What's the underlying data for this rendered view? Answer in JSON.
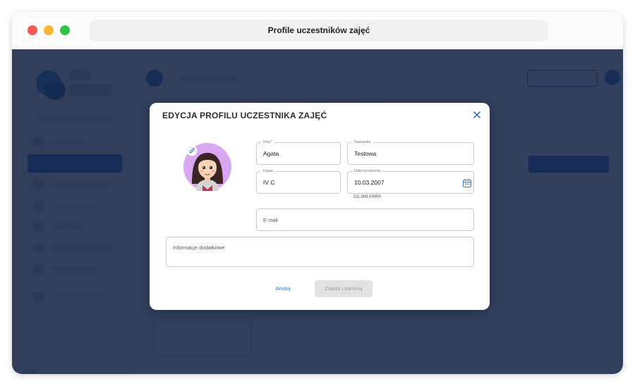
{
  "window": {
    "title": "Profile uczestników zajęć"
  },
  "modal": {
    "title": "EDYCJA PROFILU UCZESTNIKA ZAJĘĆ",
    "fields": {
      "first_name": {
        "label": "Imię*",
        "value": "Agata"
      },
      "last_name": {
        "label": "Nazwisko",
        "value": "Testowa"
      },
      "class": {
        "label": "Klasa",
        "value": "IV C"
      },
      "birth_date": {
        "label": "Data urodzenia",
        "value": "10.03.2007",
        "hint": "DD.MM.RRRR"
      },
      "email": {
        "placeholder": "E mail"
      },
      "additional_info": {
        "placeholder": "Informacje dodatkowe"
      }
    },
    "buttons": {
      "cancel": "Anuluj",
      "save": "Zapisz i zamknij"
    }
  },
  "icons": {
    "close": "close-icon",
    "edit": "pencil-icon",
    "calendar": "calendar-icon",
    "avatar": "girl-avatar"
  },
  "colors": {
    "accent": "#3a6fc4",
    "overlay": "#102142",
    "avatar_bg": "#d9a6f0",
    "window_red": "#f25b57",
    "window_yellow": "#f6b532",
    "window_green": "#2fc446"
  }
}
